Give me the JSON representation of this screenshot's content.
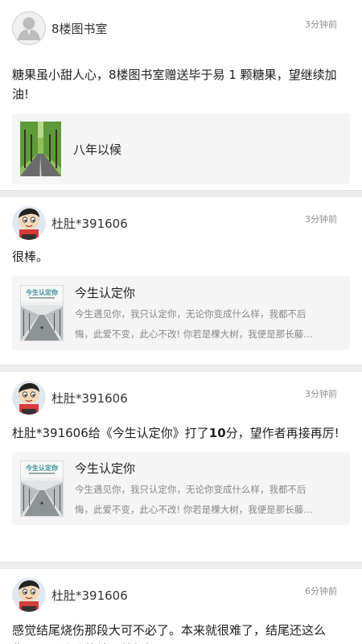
{
  "comments": [
    {
      "username": "8楼图书室",
      "time": "3分钟前",
      "avatar": "default-user-avatar",
      "text": "糖果虽小甜人心，8楼图书室赠送毕于易 1 颗糖果，望继续加油!",
      "book": {
        "title": "八年以候",
        "desc_line1": "",
        "desc_line2": "",
        "cover": "tree-lined-road-cover"
      }
    },
    {
      "username": "杜肚*391606",
      "time": "3分钟前",
      "avatar": "cartoon-boy-avatar",
      "text": "很棒。",
      "book": {
        "title": "今生认定你",
        "cover_text": "今生认定你",
        "desc_line1": "今生遇见你，我只认定你，无论你变成什么样，我都不后",
        "desc_line2": "悔，此爱不变，此心不改! 你若是棵大树，我便是那长藤…"
      }
    },
    {
      "username": "杜肚*391606",
      "time": "3分钟前",
      "avatar": "cartoon-boy-avatar",
      "text_prefix": "杜肚*391606给《今生认定你》打了",
      "text_score": "10",
      "text_suffix": "分，望作者再接再厉!",
      "book": {
        "title": "今生认定你",
        "cover_text": "今生认定你",
        "desc_line1": "今生遇见你，我只认定你，无论你变成什么样，我都不后",
        "desc_line2": "悔，此爱不变，此心不改! 你若是棵大树，我便是那长藤…"
      }
    },
    {
      "username": "杜肚*391606",
      "time": "6分钟前",
      "avatar": "cartoon-boy-avatar",
      "text": "感觉结尾烧伤那段大可不必了。本来就很难了，结尾还这么伤。平平淡淡的结尾就很好了。"
    }
  ],
  "colors": {
    "divider": "#ededed",
    "book_bg": "#f5f5f5",
    "time": "#8f8f8f"
  }
}
